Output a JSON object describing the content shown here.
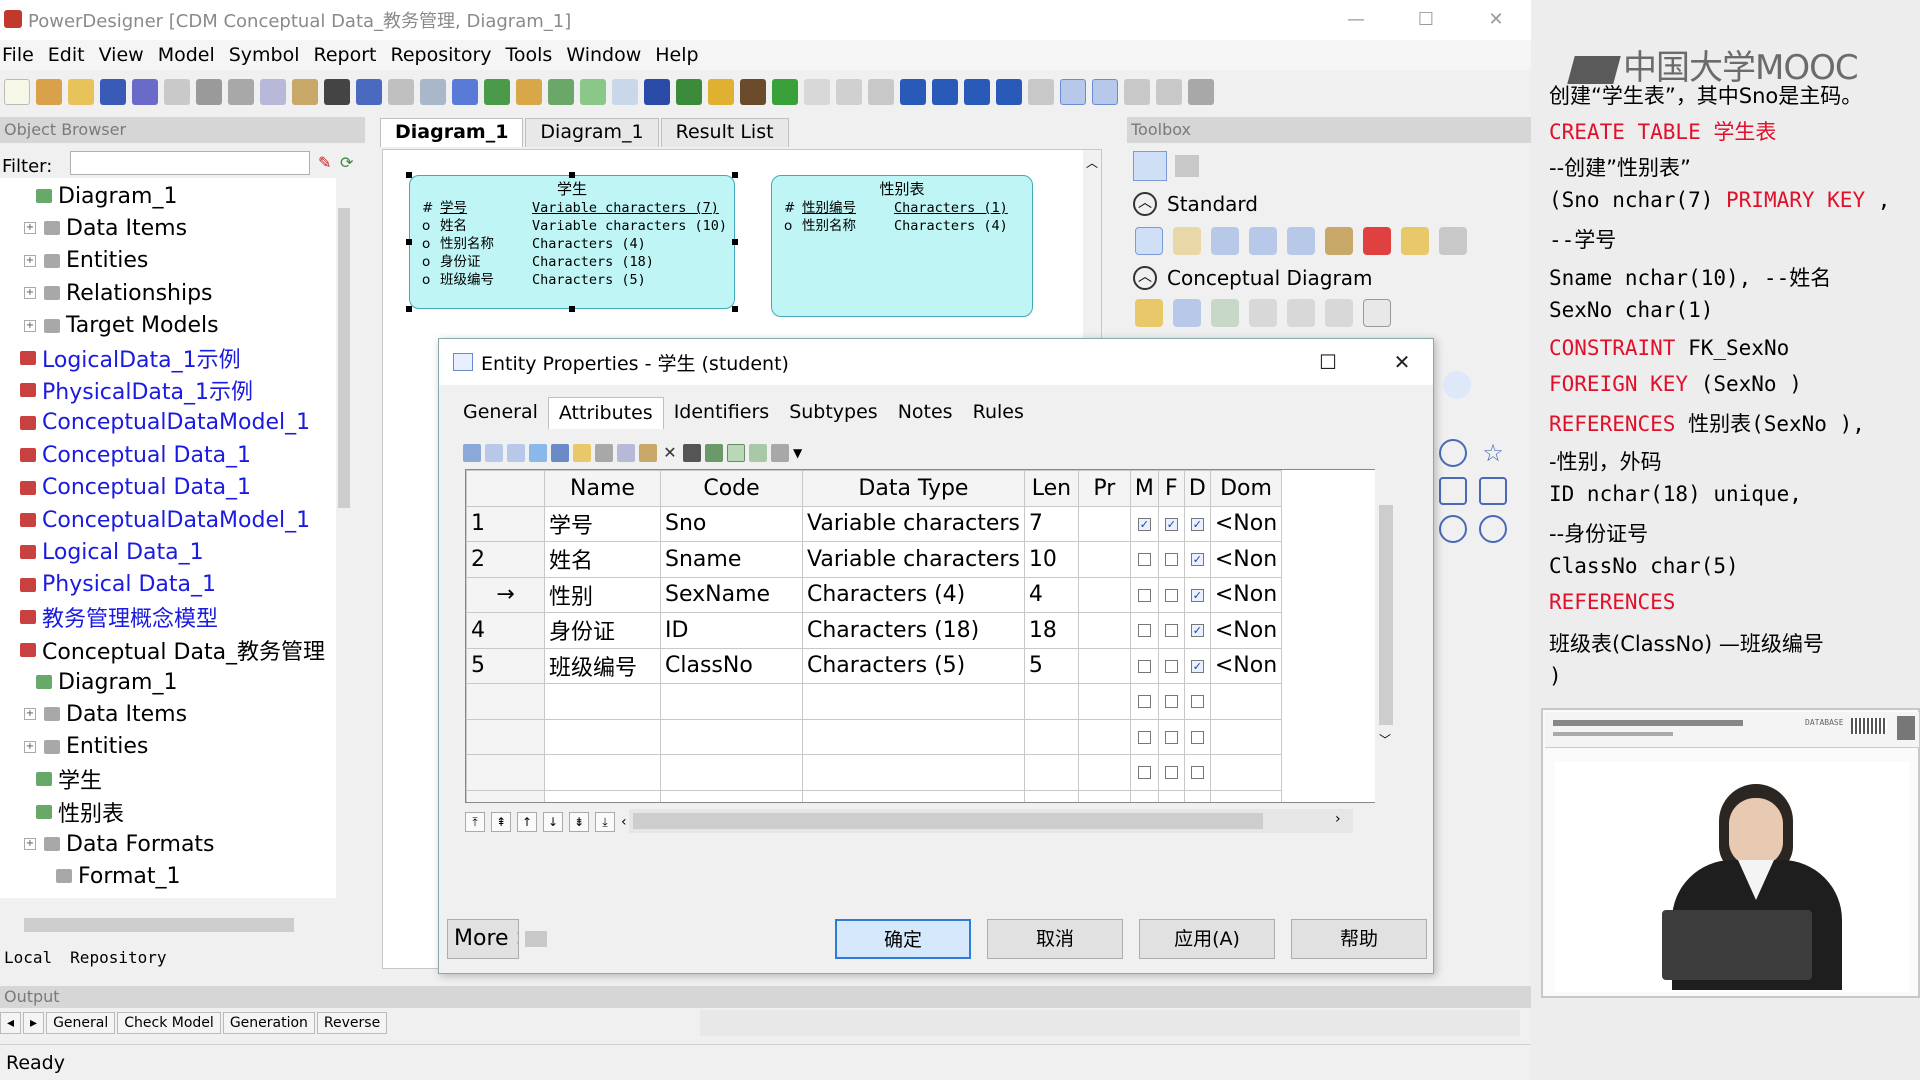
{
  "window": {
    "title": "PowerDesigner [CDM Conceptual Data_教务管理, Diagram_1]"
  },
  "menu": [
    "File",
    "Edit",
    "View",
    "Model",
    "Symbol",
    "Report",
    "Repository",
    "Tools",
    "Window",
    "Help"
  ],
  "object_browser": {
    "header": "Object Browser",
    "filter_label": "Filter:",
    "tree": [
      {
        "label": "Diagram_1",
        "indent": 2,
        "blue": false
      },
      {
        "label": "Data Items",
        "indent": 1,
        "blue": false
      },
      {
        "label": "Entities",
        "indent": 1,
        "blue": false
      },
      {
        "label": "Relationships",
        "indent": 1,
        "blue": false
      },
      {
        "label": "Target Models",
        "indent": 1,
        "blue": false
      },
      {
        "label": "LogicalData_1示例",
        "indent": 0,
        "blue": true
      },
      {
        "label": "PhysicalData_1示例",
        "indent": 0,
        "blue": true
      },
      {
        "label": "ConceptualDataModel_1",
        "indent": 0,
        "blue": true
      },
      {
        "label": "Conceptual Data_1",
        "indent": 0,
        "blue": true
      },
      {
        "label": "Conceptual Data_1",
        "indent": 0,
        "blue": true
      },
      {
        "label": "ConceptualDataModel_1",
        "indent": 0,
        "blue": true
      },
      {
        "label": "Logical Data_1",
        "indent": 0,
        "blue": true
      },
      {
        "label": "Physical Data_1",
        "indent": 0,
        "blue": true
      },
      {
        "label": "教务管理概念模型",
        "indent": 0,
        "blue": true
      },
      {
        "label": "Conceptual Data_教务管理",
        "indent": 0,
        "blue": false
      },
      {
        "label": "Diagram_1",
        "indent": 2,
        "blue": false
      },
      {
        "label": "Data Items",
        "indent": 1,
        "blue": false
      },
      {
        "label": "Entities",
        "indent": 1,
        "blue": false
      },
      {
        "label": "学生",
        "indent": 2,
        "blue": false
      },
      {
        "label": "性别表",
        "indent": 2,
        "blue": false
      },
      {
        "label": "Data Formats",
        "indent": 1,
        "blue": false
      },
      {
        "label": "Format_1",
        "indent": 3,
        "blue": false
      }
    ],
    "bottom_tabs": [
      "Local",
      "Repository"
    ]
  },
  "diagram": {
    "tabs": [
      "Diagram_1",
      "Diagram_1",
      "Result List"
    ],
    "entities": [
      {
        "title": "学生",
        "rows": [
          {
            "mark": "#",
            "name": "学号",
            "type": "Variable characters (7)",
            "pk": true
          },
          {
            "mark": "o",
            "name": "姓名",
            "type": "Variable characters (10)",
            "pk": false
          },
          {
            "mark": "o",
            "name": "性别名称",
            "type": "Characters (4)",
            "pk": false
          },
          {
            "mark": "o",
            "name": "身份证",
            "type": "Characters (18)",
            "pk": false
          },
          {
            "mark": "o",
            "name": "班级编号",
            "type": "Characters (5)",
            "pk": false
          }
        ]
      },
      {
        "title": "性别表",
        "rows": [
          {
            "mark": "#",
            "name": "性别编号",
            "type": "Characters (1)",
            "pk": true
          },
          {
            "mark": "o",
            "name": "性别名称",
            "type": "Characters (4)",
            "pk": false
          }
        ]
      }
    ]
  },
  "toolbox": {
    "header": "Toolbox",
    "sections": [
      "Standard",
      "Conceptual Diagram"
    ]
  },
  "dialog": {
    "title": "Entity Properties - 学生 (student)",
    "tabs": [
      "General",
      "Attributes",
      "Identifiers",
      "Subtypes",
      "Notes",
      "Rules"
    ],
    "active_tab": "Attributes",
    "columns": [
      "Name",
      "Code",
      "Data Type",
      "Len",
      "Pr",
      "M",
      "F",
      "D",
      "Dom"
    ],
    "rows": [
      {
        "num": "1",
        "name": "学号",
        "code": "Sno",
        "type": "Variable characters",
        "len": "7",
        "m": true,
        "f": true,
        "d": true,
        "dom": "<Non"
      },
      {
        "num": "2",
        "name": "姓名",
        "code": "Sname",
        "type": "Variable characters",
        "len": "10",
        "m": false,
        "f": false,
        "d": true,
        "dom": "<Non"
      },
      {
        "num": "→",
        "name": "性别",
        "code": "SexName",
        "type": "Characters (4)",
        "len": "4",
        "m": false,
        "f": false,
        "d": true,
        "dom": "<Non"
      },
      {
        "num": "4",
        "name": "身份证",
        "code": "ID",
        "type": "Characters (18)",
        "len": "18",
        "m": false,
        "f": false,
        "d": true,
        "dom": "<Non"
      },
      {
        "num": "5",
        "name": "班级编号",
        "code": "ClassNo",
        "type": "Characters (5)",
        "len": "5",
        "m": false,
        "f": false,
        "d": true,
        "dom": "<Non"
      }
    ],
    "empty_rows": 5,
    "more_label": "More >>",
    "buttons": {
      "ok": "确定",
      "cancel": "取消",
      "apply": "应用(A)",
      "help": "帮助"
    }
  },
  "output": {
    "header": "Output",
    "tabs": [
      "General",
      "Check Model",
      "Generation",
      "Reverse"
    ]
  },
  "status": "Ready",
  "lecture": {
    "logo": "中国大学MOOC",
    "lines": [
      {
        "text": "创建“学生表”，其中Sno是主码。",
        "red": false
      },
      {
        "text": "CREATE TABLE 学生表",
        "red": true
      },
      {
        "text": "--创建”性别表”",
        "red": false
      },
      {
        "text": "(Sno nchar(7)  PRIMARY KEY ,",
        "red": false,
        "red_part": "PRIMARY KEY"
      },
      {
        "text": "    --学号",
        "red": false
      },
      {
        "text": " Sname nchar(10), --姓名",
        "red": false
      },
      {
        "text": " SexNo  char(1)",
        "red": false
      },
      {
        "text": "CONSTRAINT FK_SexNo",
        "red": false,
        "red_part": "CONSTRAINT"
      },
      {
        "text": "FOREIGN KEY (SexNo )",
        "red": false,
        "red_part": "FOREIGN KEY"
      },
      {
        "text": "REFERENCES 性别表(SexNo ),",
        "red": false,
        "red_part": "REFERENCES"
      },
      {
        "text": " -性别，外码",
        "red": false
      },
      {
        "text": " ID  nchar(18)  unique,",
        "red": false
      },
      {
        "text": " --身份证号",
        "red": false
      },
      {
        "text": "ClassNo char(5)",
        "red": false
      },
      {
        "text": "REFERENCES",
        "red": true
      },
      {
        "text": "班级表(ClassNo)  —班级编号",
        "red": false
      },
      {
        "text": ")",
        "red": false
      }
    ],
    "video_label": "DATABASE"
  }
}
